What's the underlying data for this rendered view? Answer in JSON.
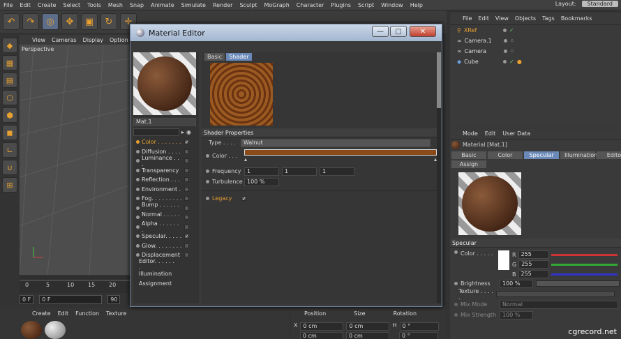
{
  "menubar": {
    "items": [
      "File",
      "Edit",
      "Create",
      "Select",
      "Tools",
      "Mesh",
      "Snap",
      "Animate",
      "Simulate",
      "Render",
      "Sculpt",
      "MoGraph",
      "Character",
      "Plugins",
      "Script",
      "Window",
      "Help"
    ],
    "layout_label": "Layout:",
    "layout_value": "Standard"
  },
  "viewport": {
    "menu": [
      "View",
      "Cameras",
      "Display",
      "Option"
    ],
    "label": "Perspective"
  },
  "timeline": {
    "ticks": [
      "0",
      "5",
      "10",
      "15",
      "20"
    ],
    "field1": "0 F",
    "field2": "0 F",
    "field3": "90"
  },
  "material_manager": {
    "menu": [
      "Create",
      "Edit",
      "Function",
      "Texture"
    ]
  },
  "coordinates": {
    "headers": [
      "Position",
      "Size",
      "Rotation"
    ],
    "x_label": "X",
    "x_pos": "0 cm",
    "x_size": "0 cm",
    "h_label": "H",
    "h_rot": "0 °",
    "y_pos": "0 cm",
    "y_size": "0 cm",
    "p_rot": "0 °"
  },
  "object_manager": {
    "menu": [
      "File",
      "Edit",
      "View",
      "Objects",
      "Tags",
      "Bookmarks"
    ],
    "objects": [
      {
        "name": "XRef"
      },
      {
        "name": "Camera.1"
      },
      {
        "name": "Camera"
      },
      {
        "name": "Cube"
      }
    ]
  },
  "attributes": {
    "menu": [
      "Mode",
      "Edit",
      "User Data"
    ],
    "title": "Material [Mat.1]",
    "tabs": [
      "Basic",
      "Color",
      "Specular",
      "Illumination",
      "Edito"
    ],
    "tab_assign": "Assign",
    "section": "Specular",
    "color_label": "Color . . . . .",
    "r_label": "R",
    "g_label": "G",
    "b_label": "B",
    "r": "255",
    "g": "255",
    "b": "255",
    "brightness_label": "Brightness",
    "brightness": "100 %",
    "texture_label": "Texture . . . . .",
    "mixmode_label": "Mix Mode",
    "mixmode": "Normal",
    "mixstrength_label": "Mix Strength",
    "mixstrength": "100 %"
  },
  "material_editor": {
    "title": "Material Editor",
    "mat_name": "Mat.1",
    "tabs": [
      "Basic",
      "Shader"
    ],
    "section": "Shader Properties",
    "type_label": "Type . . . .",
    "type_value": "Walnut",
    "color_label": "Color . . .",
    "frequency_label": "Frequency",
    "freq": [
      "1",
      "1",
      "1"
    ],
    "turbulence_label": "Turbulence",
    "turbulence": "100 %",
    "legacy_label": "Legacy",
    "channels": [
      {
        "name": "Color . . . . . . .",
        "checked": "✓",
        "active": true
      },
      {
        "name": "Diffusion . . . .",
        "checked": ""
      },
      {
        "name": "Luminance . . .",
        "checked": ""
      },
      {
        "name": "Transparency",
        "checked": ""
      },
      {
        "name": "Reflection . . .",
        "checked": ""
      },
      {
        "name": "Environment .",
        "checked": ""
      },
      {
        "name": "Fog. . . . . . . . .",
        "checked": ""
      },
      {
        "name": "Bump . . . . . . .",
        "checked": ""
      },
      {
        "name": "Normal . . . . . .",
        "checked": ""
      },
      {
        "name": "Alpha . . . . . . .",
        "checked": ""
      },
      {
        "name": "Specular. . . . .",
        "checked": "✓"
      },
      {
        "name": "Glow. . . . . . . .",
        "checked": ""
      },
      {
        "name": "Displacement",
        "checked": ""
      }
    ],
    "extra": [
      "Editor. . . . . . .",
      "Illumination",
      "Assignment"
    ]
  },
  "watermark": "cgrecord.net",
  "colors": {
    "accent": "#e8a030",
    "tab_active": "#6a89b8",
    "walnut": "#8a4a1a"
  }
}
